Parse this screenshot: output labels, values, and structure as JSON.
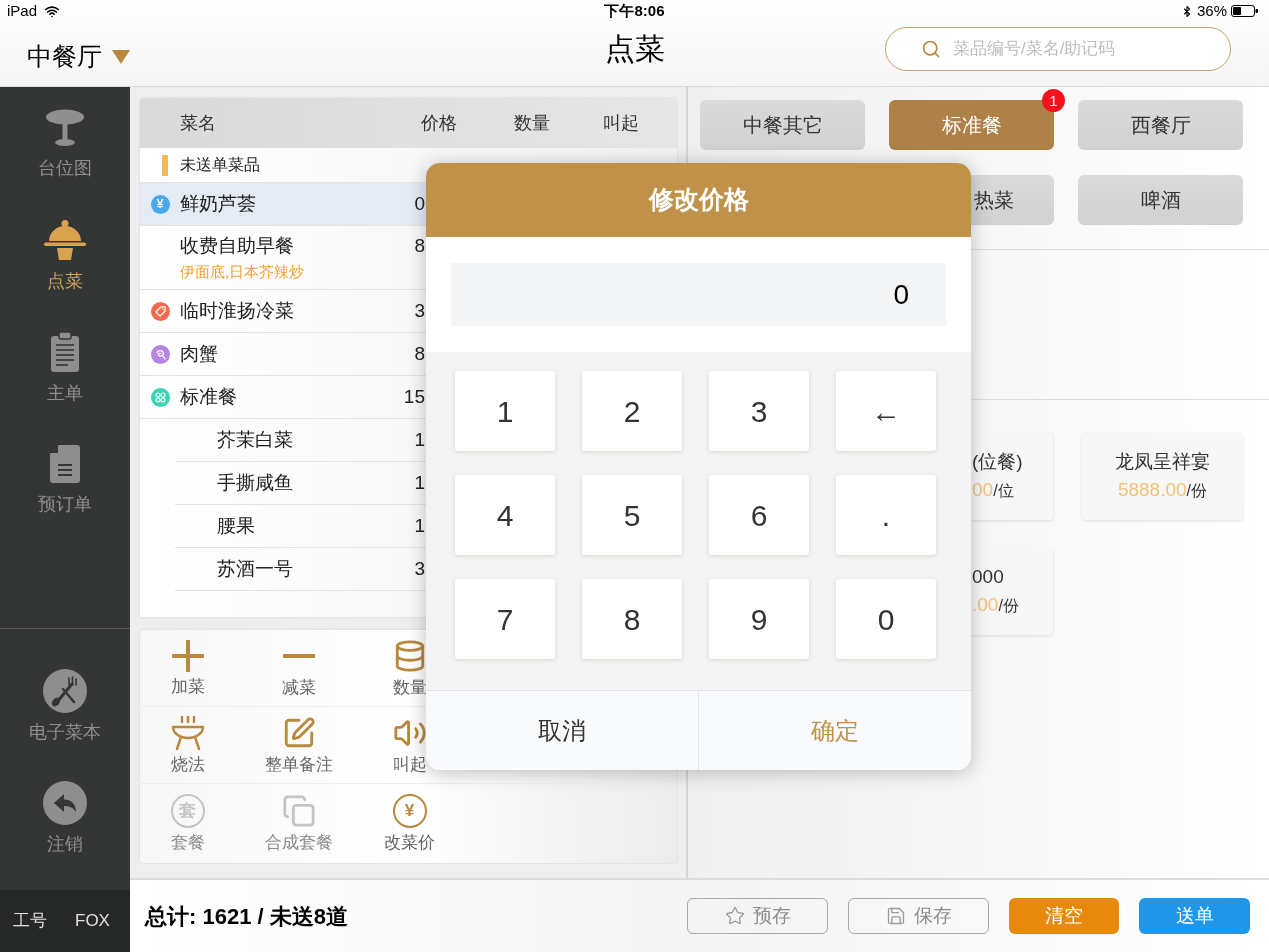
{
  "status_bar": {
    "device": "iPad",
    "time": "下午8:06",
    "battery": "36%"
  },
  "header": {
    "venue": "中餐厅",
    "title": "点菜",
    "search": {
      "placeholder": "菜品编号/菜名/助记码"
    }
  },
  "sidebar": {
    "items": [
      {
        "label": "台位图",
        "selected": false
      },
      {
        "label": "点菜",
        "selected": true
      },
      {
        "label": "主单",
        "selected": false
      },
      {
        "label": "预订单",
        "selected": false
      }
    ],
    "bottom_items": [
      {
        "label": "电子菜本"
      },
      {
        "label": "注销"
      }
    ],
    "footer": {
      "label": "工号",
      "value": "FOX"
    }
  },
  "order_table": {
    "columns": [
      "菜名",
      "价格",
      "数量",
      "叫起"
    ],
    "section": "未送单菜品",
    "rows": [
      {
        "name": "鲜奶芦荟",
        "price": "0",
        "selected": true,
        "tag": {
          "kind": "price",
          "glyph": "¥",
          "color": "#4aa7ea"
        }
      },
      {
        "name": "收费自助早餐",
        "price": "8",
        "note": "伊面底,日本芥辣炒",
        "selected": false
      },
      {
        "name": "临时淮扬冷菜",
        "price": "3",
        "selected": false,
        "tag": {
          "kind": "temporary",
          "color": "#f26b4f"
        }
      },
      {
        "name": "肉蟹",
        "price": "8",
        "selected": false,
        "tag": {
          "kind": "weigh",
          "color": "#b585e0"
        }
      },
      {
        "name": "标准餐",
        "price": "15",
        "selected": false,
        "tag": {
          "kind": "set",
          "color": "#3ed3b4"
        },
        "children": [
          {
            "name": "芥茉白菜",
            "price": "1",
            "selected": false
          },
          {
            "name": "手撕咸鱼",
            "price": "1",
            "selected": false
          },
          {
            "name": "腰果",
            "price": "1",
            "selected": false
          },
          {
            "name": "苏酒一号",
            "price": "3",
            "selected": false
          }
        ]
      }
    ]
  },
  "toolbar": {
    "rows": [
      [
        {
          "label": "加菜",
          "disabled": false
        },
        {
          "label": "减菜",
          "disabled": false
        },
        {
          "label": "数量",
          "disabled": false
        }
      ],
      [
        {
          "label": "烧法",
          "disabled": false
        },
        {
          "label": "整单备注",
          "disabled": false
        },
        {
          "label": "叫起",
          "disabled": false
        }
      ],
      [
        {
          "label": "套餐",
          "glyph": "套",
          "disabled": true
        },
        {
          "label": "合成套餐",
          "disabled": true
        },
        {
          "label": "改菜价",
          "glyph": "¥",
          "disabled": false
        }
      ]
    ]
  },
  "categories": {
    "rows": [
      [
        {
          "label": "中餐其它",
          "selected": false
        },
        {
          "label": "标准餐",
          "selected": true,
          "badge": "1"
        },
        {
          "label": "西餐厅",
          "selected": false
        }
      ],
      [
        "",
        {
          "label": "热菜",
          "selected": false
        },
        {
          "label": "啤酒",
          "selected": false
        }
      ]
    ]
  },
  "dishes": {
    "rows": [
      [
        {
          "name": "(位餐)",
          "price": "00",
          "unit": "/位"
        },
        {
          "name": "龙凤呈祥宴",
          "price": "5888.00",
          "unit": "/份"
        }
      ],
      [
        {
          "name": "000",
          "price": ".00",
          "unit": "/份"
        }
      ]
    ]
  },
  "footer": {
    "summary": "总计: 1621 / 未送8道",
    "buttons": [
      {
        "label": "预存",
        "kind": "outline"
      },
      {
        "label": "保存",
        "kind": "outline"
      },
      {
        "label": "清空",
        "kind": "warning"
      },
      {
        "label": "送单",
        "kind": "primary"
      }
    ]
  },
  "dialog": {
    "title": "修改价格",
    "value": "0",
    "keys": [
      "1",
      "2",
      "3",
      "←",
      "4",
      "5",
      "6",
      ".",
      "7",
      "8",
      "9",
      "0"
    ],
    "buttons": [
      {
        "label": "取消",
        "kind": "cancel"
      },
      {
        "label": "确定",
        "kind": "confirm"
      }
    ]
  }
}
